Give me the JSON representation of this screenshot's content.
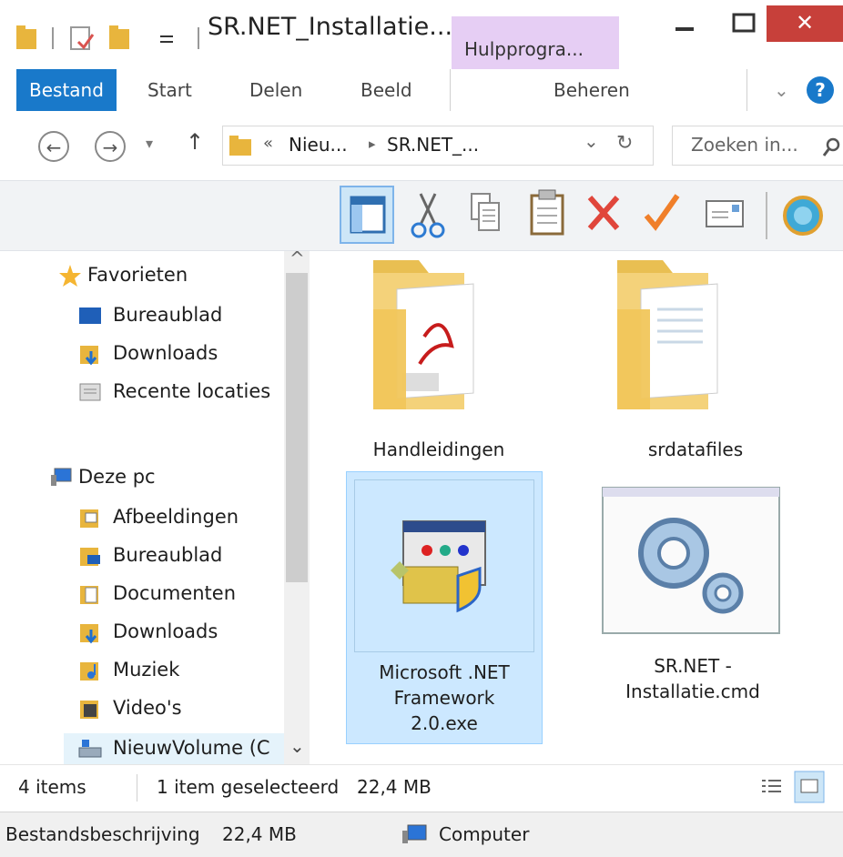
{
  "window": {
    "title": "SR.NET_Installatie...",
    "context_tab": "Hulpprogra...",
    "min_glyph": "−",
    "max_glyph": "☐",
    "close_glyph": "✕"
  },
  "ribbon": {
    "tabs": [
      "Bestand",
      "Start",
      "Delen",
      "Beeld"
    ],
    "context_group": "Beheren",
    "expand_glyph": "⌄",
    "help_glyph": "?"
  },
  "address": {
    "back_glyph": "←",
    "forward_glyph": "→",
    "recent_glyph": "▾",
    "up_glyph": "↑",
    "overflow": "«",
    "crumb1": "Nieu...",
    "crumb_sep": "▸",
    "crumb2": "SR.NET_...",
    "dropdown_glyph": "⌄",
    "refresh_glyph": "↻",
    "search_placeholder": "Zoeken in..."
  },
  "toolbar": {
    "icons": [
      "layout-pane-icon",
      "cut-icon",
      "copy-icon",
      "paste-icon",
      "delete-icon",
      "check-icon",
      "properties-icon",
      "shell-icon"
    ]
  },
  "navpane": {
    "favorites_header": "Favorieten",
    "favorites": [
      "Bureaublad",
      "Downloads",
      "Recente locaties"
    ],
    "pc_header": "Deze pc",
    "pc_items": [
      "Afbeeldingen",
      "Bureaublad",
      "Documenten",
      "Downloads",
      "Muziek",
      "Video's",
      "NieuwVolume (C"
    ],
    "scroll_up": "^",
    "scroll_down": "⌄"
  },
  "files": [
    {
      "name": "Handleidingen",
      "type": "folder"
    },
    {
      "name": "srdatafiles",
      "type": "folder"
    },
    {
      "name_lines": [
        "Microsoft .NET",
        "Framework",
        "2.0.exe"
      ],
      "type": "installer",
      "selected": true
    },
    {
      "name_lines": [
        "SR.NET -",
        "Installatie.cmd"
      ],
      "type": "cmd"
    }
  ],
  "status": {
    "count": "4 items",
    "selected": "1 item geselecteerd",
    "size": "22,4 MB"
  },
  "details": {
    "description": "Bestandsbeschrijving",
    "size": "22,4 MB",
    "location": "Computer"
  },
  "colors": {
    "accent": "#1979ca",
    "context_tab": "#e6cef4",
    "close": "#c7403a",
    "selection": "#cce8ff",
    "folder": "#f1c65b"
  }
}
